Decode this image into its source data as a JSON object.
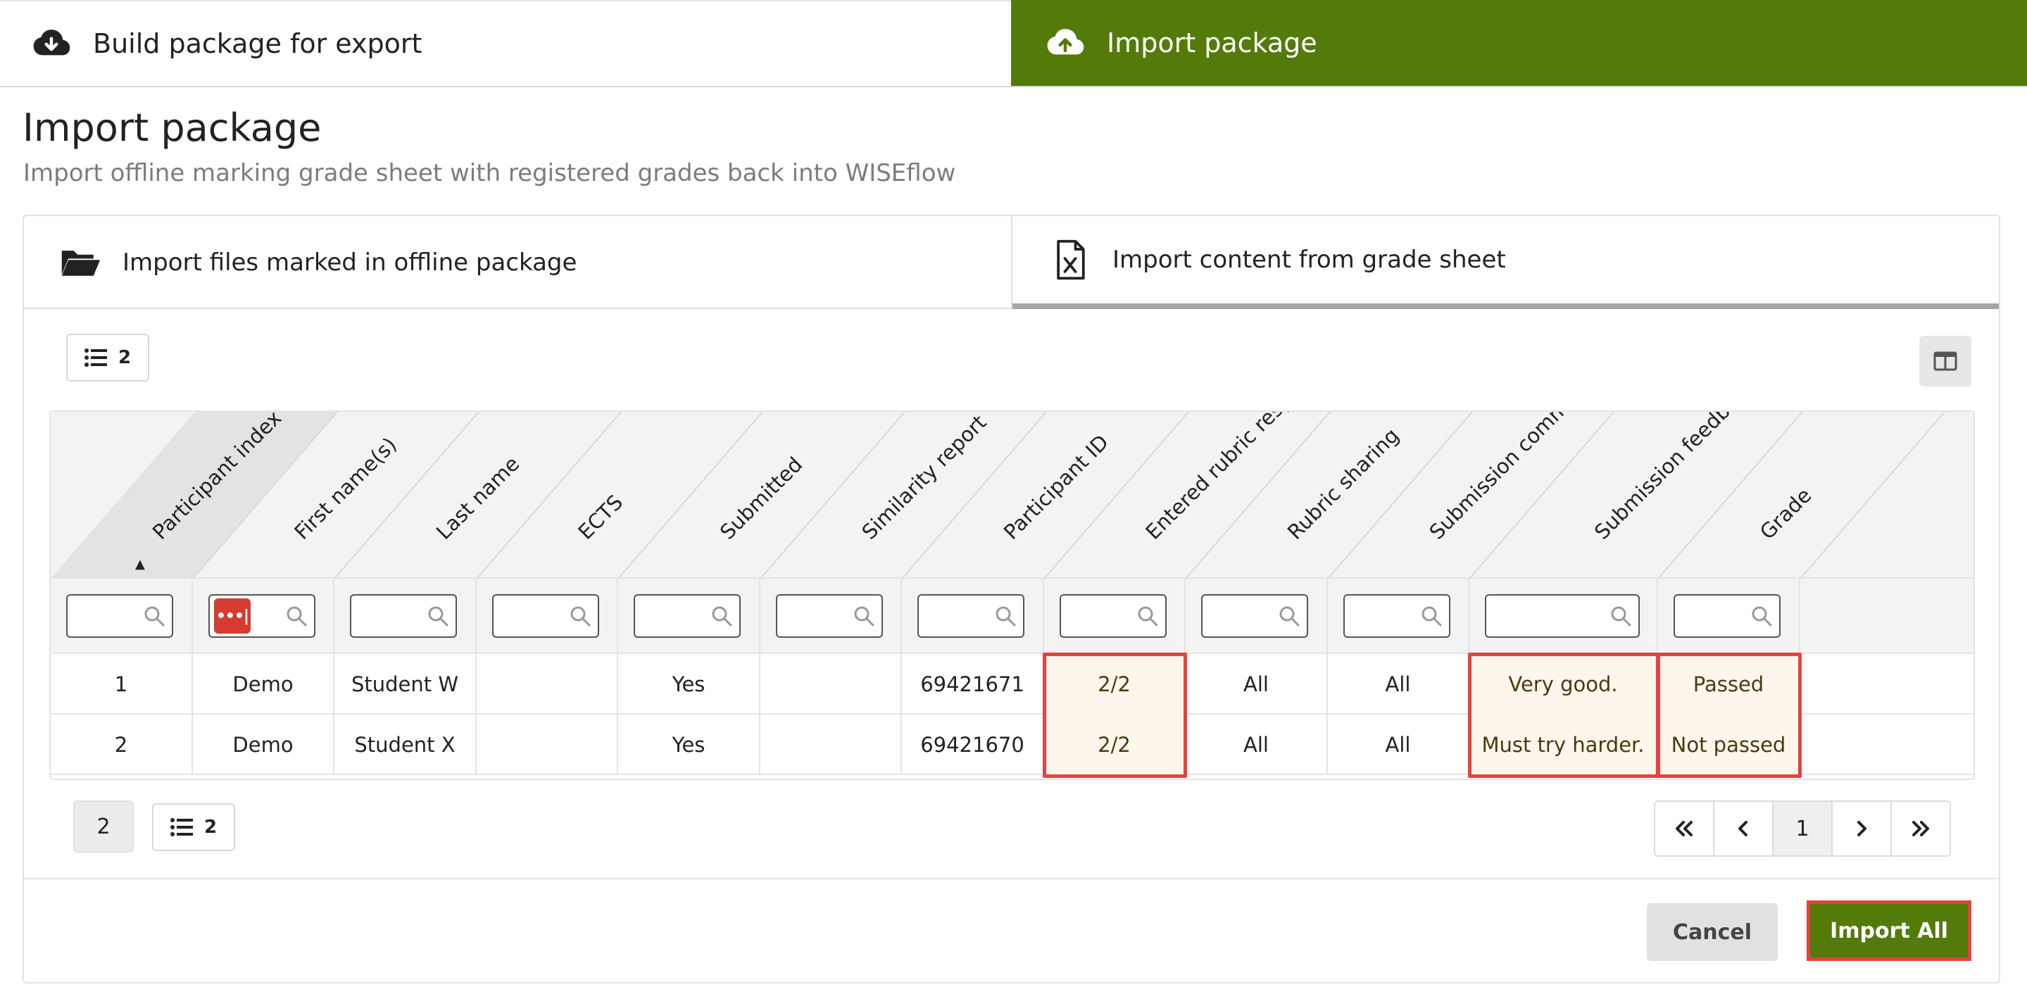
{
  "top_tabs": {
    "export_label": "Build package for export",
    "import_label": "Import package"
  },
  "heading": {
    "title": "Import package",
    "subtitle": "Import offline marking grade sheet with registered grades back into WISEflow"
  },
  "inner_tabs": {
    "files_label": "Import files marked in offline package",
    "sheet_label": "Import content from grade sheet"
  },
  "toolbar": {
    "rows_count": "2"
  },
  "grid": {
    "columns": [
      "Participant index",
      "First name(s)",
      "Last name",
      "ECTS",
      "Submitted",
      "Similarity report",
      "Participant ID",
      "Entered rubric resp...",
      "Rubric sharing",
      "Submission comme...",
      "Submission feedback",
      "Grade"
    ],
    "sort_indicator": "▲",
    "regex_filter_label": "•••|",
    "rows": [
      [
        "1",
        "Demo",
        "Student W",
        "",
        "Yes",
        "",
        "69421671",
        "2/2",
        "All",
        "All",
        "Very good.",
        "Passed"
      ],
      [
        "2",
        "Demo",
        "Student X",
        "",
        "Yes",
        "",
        "69421670",
        "2/2",
        "All",
        "All",
        "Must try harder.",
        "Not passed"
      ]
    ]
  },
  "footer_left": {
    "page_count": "2",
    "rows_count": "2"
  },
  "pager": {
    "first": "«",
    "prev": "‹",
    "current": "1",
    "next": "›",
    "last": "»"
  },
  "actions": {
    "cancel_label": "Cancel",
    "import_all_label": "Import All"
  },
  "colors": {
    "brand_green": "#537b0a",
    "highlight_red": "#e8413f",
    "highlight_cell_bg": "#fdf6ec"
  }
}
